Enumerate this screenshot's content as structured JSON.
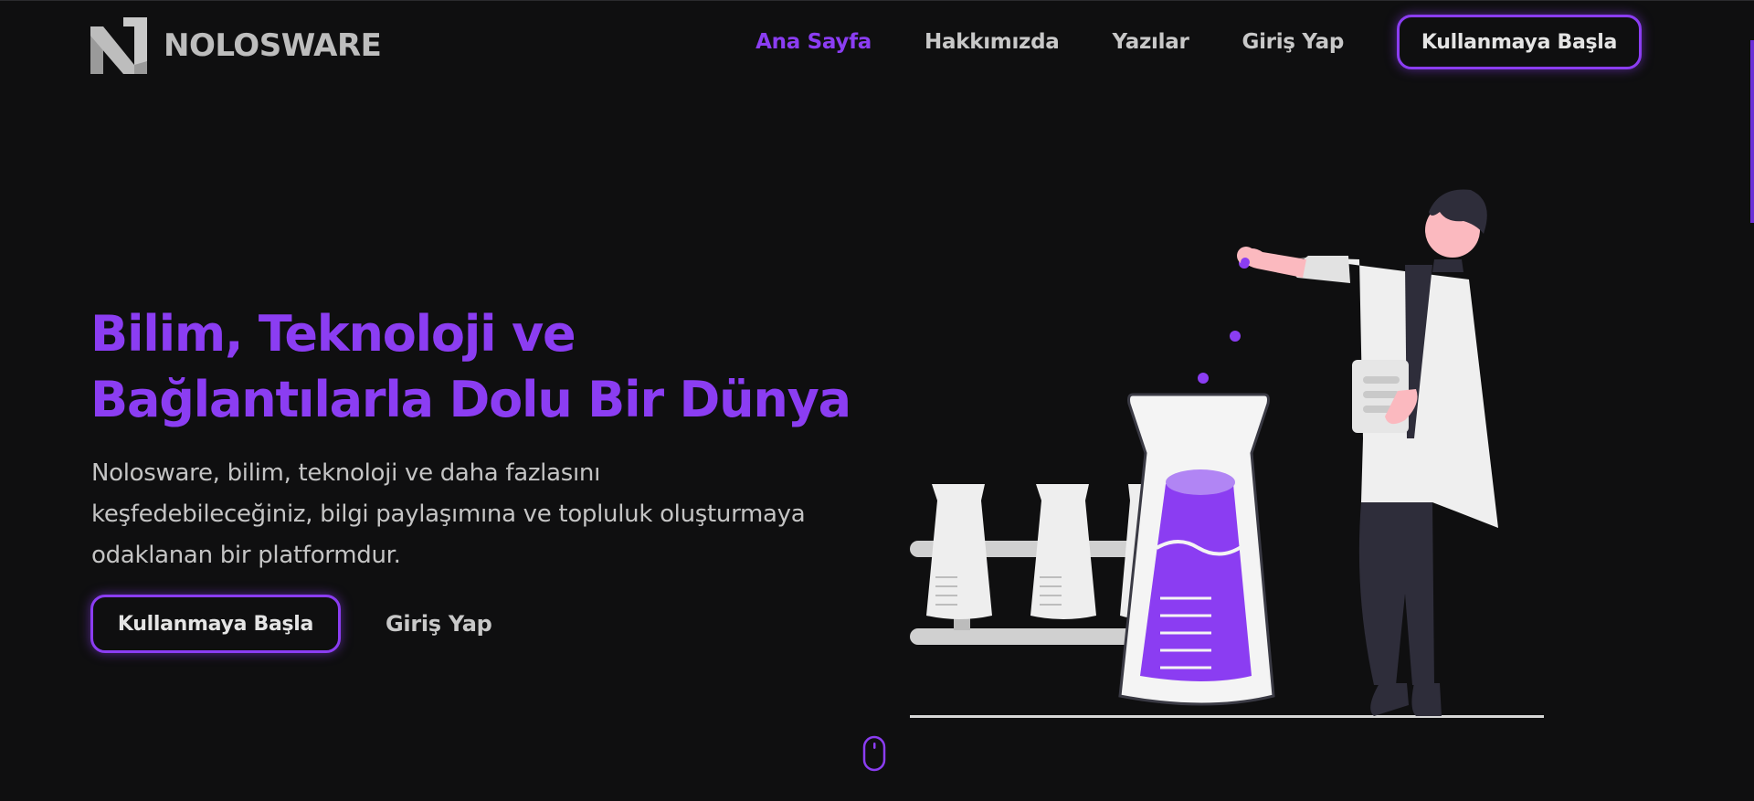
{
  "brand": {
    "name": "NOLOSWARE",
    "logo_icon": "n-logo-icon"
  },
  "nav": {
    "items": [
      {
        "label": "Ana Sayfa",
        "active": true
      },
      {
        "label": "Hakkımızda",
        "active": false
      },
      {
        "label": "Yazılar",
        "active": false
      },
      {
        "label": "Giriş Yap",
        "active": false
      }
    ],
    "cta_label": "Kullanmaya Başla"
  },
  "hero": {
    "title_line1": "Bilim, Teknoloji ve",
    "title_line2": "Bağlantılarla Dolu Bir Dünya",
    "description_line1": "Nolosware, bilim, teknoloji ve daha fazlasını",
    "description_line2": "keşfedebileceğiniz, bilgi paylaşımına ve topluluk oluşturmaya",
    "description_line3": "odaklanan bir platformdur.",
    "primary_button": "Kullanmaya Başla",
    "secondary_button": "Giriş Yap"
  },
  "icons": {
    "scroll_indicator": "mouse-scroll-icon",
    "illustration": "scientist-lab-illustration"
  },
  "colors": {
    "background": "#0f0f10",
    "accent": "#8b3df2",
    "text": "#c4c4c4"
  }
}
